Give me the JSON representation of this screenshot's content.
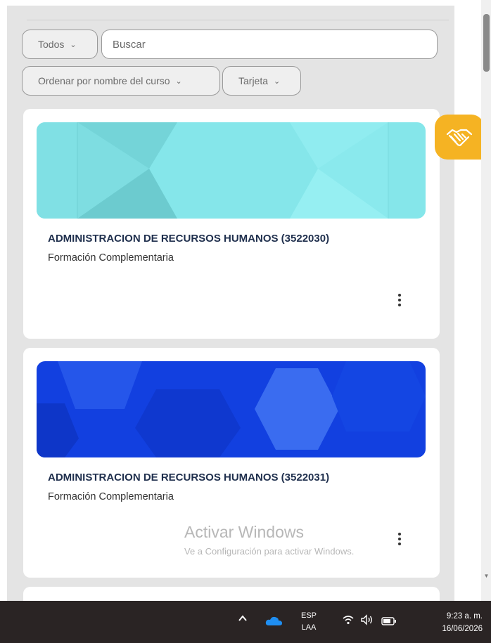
{
  "filters": {
    "category_label": "Todos",
    "search_placeholder": "Buscar",
    "sort_label": "Ordenar por nombre del curso",
    "view_label": "Tarjeta"
  },
  "courses": [
    {
      "title": "ADMINISTRACION DE RECURSOS HUMANOS (3522030)",
      "category": "Formación Complementaria",
      "banner_color": "#85e6ea"
    },
    {
      "title": "ADMINISTRACION DE RECURSOS HUMANOS (3522031)",
      "category": "Formación Complementaria",
      "banner_color": "#1240e0"
    }
  ],
  "watermark": {
    "line1": "Activar Windows",
    "line2": "Ve a Configuración para activar Windows."
  },
  "help_button": {
    "icon": "handshake-icon",
    "color": "#f5b323"
  },
  "taskbar": {
    "lang_line1": "ESP",
    "lang_line2": "LAA",
    "time": "9:23 a. m.",
    "date": "16/06/2026"
  }
}
